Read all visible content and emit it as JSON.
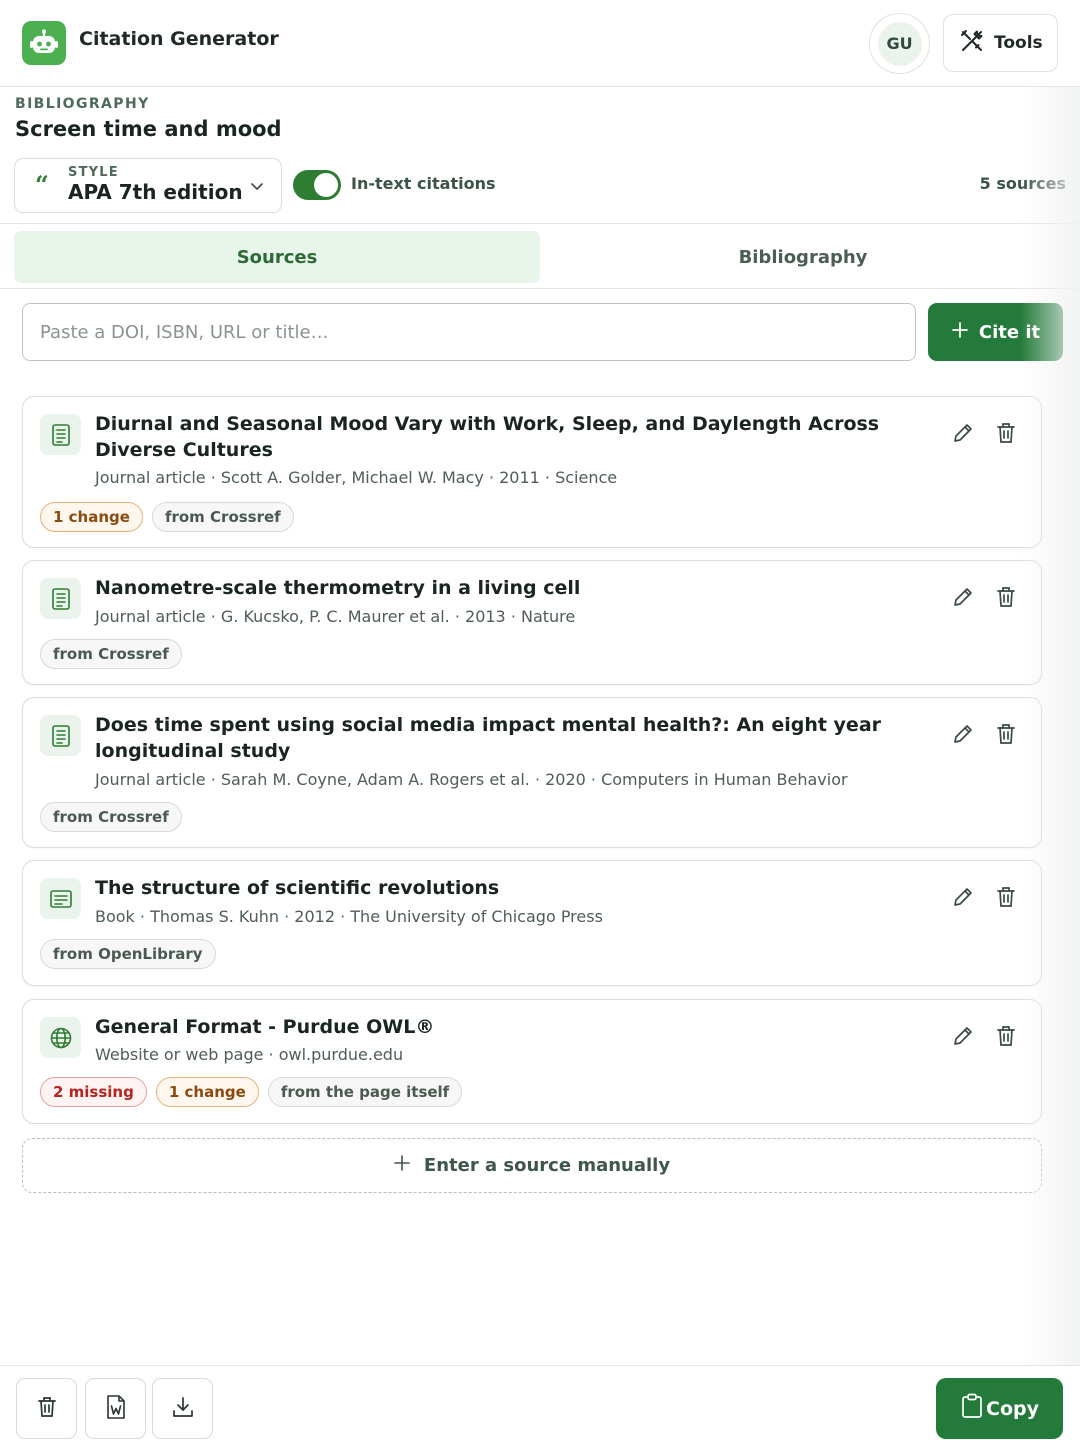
{
  "app": {
    "title": "Citation Generator"
  },
  "header": {
    "avatar_initials": "GU",
    "tools_label": "Tools"
  },
  "bibliography": {
    "eyebrow": "BIBLIOGRAPHY",
    "title": "Screen time and mood"
  },
  "style": {
    "label": "STYLE",
    "value": "APA 7th edition"
  },
  "intext": {
    "label": "In-text citations",
    "enabled": true
  },
  "source_count": "5 sources",
  "tabs": [
    {
      "label": "Sources",
      "active": true
    },
    {
      "label": "Bibliography",
      "active": false
    }
  ],
  "search": {
    "placeholder": "Paste a DOI, ISBN, URL or title…",
    "value": ""
  },
  "cite_button": {
    "label": "Cite it"
  },
  "sources": [
    {
      "icon": "journal-article-icon",
      "title": "Diurnal and Seasonal Mood Vary with Work, Sleep, and Daylength Across Diverse Cultures",
      "meta": "Journal article · Scott A. Golder, Michael W. Macy · 2011 · Science",
      "tags": [
        {
          "label": "1 change",
          "kind": "change"
        },
        {
          "label": "from Crossref",
          "kind": "source"
        }
      ]
    },
    {
      "icon": "journal-article-icon",
      "title": "Nanometre-scale thermometry in a living cell",
      "meta": "Journal article · G. Kucsko, P. C. Maurer et al. · 2013 · Nature",
      "tags": [
        {
          "label": "from Crossref",
          "kind": "source"
        }
      ]
    },
    {
      "icon": "journal-article-icon",
      "title": "Does time spent using social media impact mental health?: An eight year longitudinal study",
      "meta": "Journal article · Sarah M. Coyne, Adam A. Rogers et al. · 2020 · Computers in Human Behavior",
      "tags": [
        {
          "label": "from Crossref",
          "kind": "source"
        }
      ]
    },
    {
      "icon": "book-icon",
      "title": "The structure of scientific revolutions",
      "meta": "Book · Thomas S. Kuhn · 2012 · The University of Chicago Press",
      "tags": [
        {
          "label": "from OpenLibrary",
          "kind": "source"
        }
      ]
    },
    {
      "icon": "globe-icon",
      "title": "General Format - Purdue OWL®",
      "meta": "Website or web page · owl.purdue.edu",
      "tags": [
        {
          "label": "2 missing",
          "kind": "missing"
        },
        {
          "label": "1 change",
          "kind": "change"
        },
        {
          "label": "from the page itself",
          "kind": "source"
        }
      ]
    }
  ],
  "manual_entry": {
    "label": "Enter a source manually"
  },
  "bottom": {
    "copy_label": "Copy"
  },
  "colors": {
    "accent": "#237a3a",
    "accent_light": "#e8f5ea",
    "logo": "#4caf50",
    "change": "#8a4a10",
    "missing": "#b3261e"
  }
}
